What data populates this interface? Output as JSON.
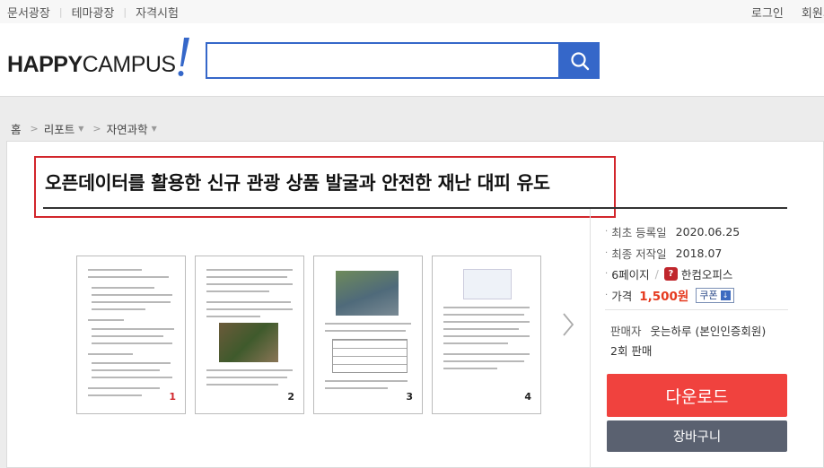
{
  "topnav": {
    "links": [
      "문서광장",
      "테마광장",
      "자격시험"
    ],
    "login": "로그인",
    "signup": "회원가"
  },
  "header": {
    "logo_bold": "HAPPY",
    "logo_rest": "CAMPUS",
    "search_placeholder": ""
  },
  "breadcrumb": {
    "home": "홈",
    "level1": "리포트",
    "level2": "자연과학"
  },
  "document": {
    "title": "오픈데이터를 활용한 신규 관광 상품 발굴과 안전한 재난 대피 유도",
    "pages": [
      "1",
      "2",
      "3",
      "4"
    ]
  },
  "info": {
    "registered_label": "최초 등록일",
    "registered_value": "2020.06.25",
    "written_label": "최종 저작일",
    "written_value": "2018.07",
    "page_count": "6페이지",
    "format": "한컴오피스",
    "price_label": "가격",
    "price_value": "1,500원",
    "coupon": "쿠폰",
    "seller_label": "판매자",
    "seller_value": "웃는하루 (본인인증회원)",
    "sales": "2회 판매"
  },
  "actions": {
    "download": "다운로드",
    "cart": "장바구니"
  },
  "colors": {
    "brand_blue": "#3567c9",
    "highlight_red": "#d2262c",
    "download_red": "#f0423e",
    "cart_gray": "#5a6170",
    "price_red": "#e53a1f"
  },
  "icons": {
    "search": "search-icon",
    "next": "chevron-right-icon",
    "hancom": "hancom-office-icon",
    "coupon_download": "download-icon"
  }
}
